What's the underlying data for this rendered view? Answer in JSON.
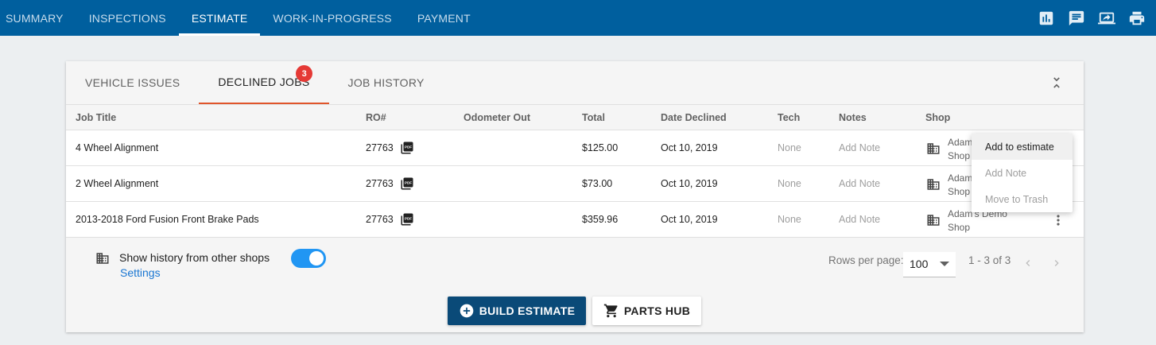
{
  "topnav": {
    "tabs": [
      {
        "label": "SUMMARY"
      },
      {
        "label": "INSPECTIONS"
      },
      {
        "label": "ESTIMATE",
        "active": true
      },
      {
        "label": "WORK-IN-PROGRESS"
      },
      {
        "label": "PAYMENT"
      }
    ],
    "icons": [
      "chart-icon",
      "message-icon",
      "share-screen-icon",
      "print-icon"
    ]
  },
  "card": {
    "tabs": [
      {
        "label": "VEHICLE ISSUES"
      },
      {
        "label": "DECLINED JOBS",
        "active": true,
        "badge": "3"
      },
      {
        "label": "JOB HISTORY"
      }
    ],
    "columns": [
      "Job Title",
      "RO#",
      "Odometer Out",
      "Total",
      "Date Declined",
      "Tech",
      "Notes",
      "Shop"
    ],
    "rows": [
      {
        "job": "4 Wheel Alignment",
        "ro": "27763",
        "odometer": "",
        "total": "$125.00",
        "date": "Oct 10, 2019",
        "tech": "None",
        "notes": "Add Note",
        "shop": "Adam's Demo Shop"
      },
      {
        "job": "2 Wheel Alignment",
        "ro": "27763",
        "odometer": "",
        "total": "$73.00",
        "date": "Oct 10, 2019",
        "tech": "None",
        "notes": "Add Note",
        "shop": "Adam's Demo Shop"
      },
      {
        "job": "2013-2018 Ford Fusion Front Brake Pads",
        "ro": "27763",
        "odometer": "",
        "total": "$359.96",
        "date": "Oct 10, 2019",
        "tech": "None",
        "notes": "Add Note",
        "shop": "Adam's Demo Shop"
      }
    ],
    "history": {
      "label": "Show history from other shops",
      "settings": "Settings",
      "enabled": true
    },
    "pager": {
      "rows_per_page_label": "Rows per page:",
      "rows_per_page": "100",
      "range": "1 - 3 of 3"
    },
    "buttons": {
      "build": "BUILD ESTIMATE",
      "parts": "PARTS HUB"
    }
  },
  "context_menu": {
    "items": [
      {
        "label": "Add to estimate",
        "active": true
      },
      {
        "label": "Add Note"
      },
      {
        "label": "Move to Trash"
      }
    ]
  },
  "colors": {
    "topbar": "#005f9e",
    "accent_tab": "#e0552b",
    "badge": "#e53935",
    "build_button": "#0a4a78",
    "toggle": "#2196f3",
    "link": "#1976d2"
  }
}
